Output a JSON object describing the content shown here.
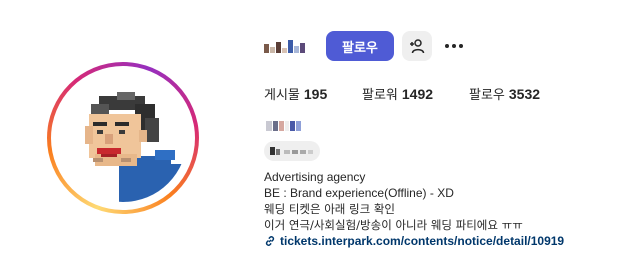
{
  "profile": {
    "username": "",
    "follow_label": "팔로우",
    "suggest_icon": "add-person-icon",
    "more_icon": "ellipsis-icon",
    "stats": {
      "posts_label": "게시물",
      "posts_value": "195",
      "followers_label": "팔로워",
      "followers_value": "1492",
      "following_label": "팔로우",
      "following_value": "3532"
    },
    "bio_lines": [
      "Advertising agency",
      "BE : Brand experience(Offline) - XD",
      "웨딩 티켓은 아래 링크 확인",
      "이거 연극/사회실험/방송이 아니라 웨딩 파티에요 ㅠㅠ"
    ],
    "link": "tickets.interpark.com/contents/notice/detail/10919"
  },
  "colors": {
    "accent": "#4f5bd5",
    "link": "#00376b",
    "ring_start": "#feda75",
    "ring_mid": "#d62976",
    "ring_end": "#962fbf"
  }
}
